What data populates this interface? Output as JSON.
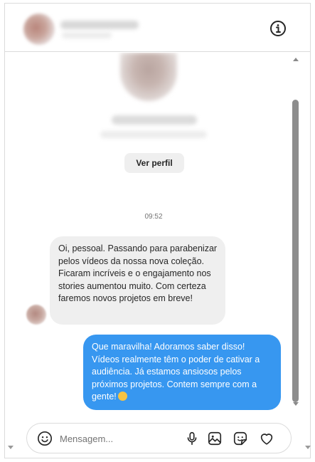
{
  "header": {
    "info_icon": "info-icon"
  },
  "profile": {
    "view_profile_label": "Ver perfil"
  },
  "thread": {
    "timestamp": "09:52",
    "messages": [
      {
        "direction": "incoming",
        "text": "Oi, pessoal. Passando para parabenizar pelos vídeos da nossa nova coleção. Ficaram incríveis e o engajamento nos stories aumentou muito. Com certeza faremos novos projetos em breve!"
      },
      {
        "direction": "outgoing",
        "text": "Que maravilha! Adoramos saber disso! Vídeos realmente têm o poder de cativar a audiência. Já estamos ansiosos pelos próximos projetos. Contem sempre com a gente!",
        "emoji": "sad-face"
      }
    ]
  },
  "composer": {
    "placeholder": "Mensagem...",
    "icons": [
      "emoji-icon",
      "microphone-icon",
      "image-icon",
      "sticker-icon",
      "heart-icon"
    ]
  },
  "colors": {
    "outgoing_bubble": "#3797f0",
    "incoming_bubble": "#efefef"
  }
}
